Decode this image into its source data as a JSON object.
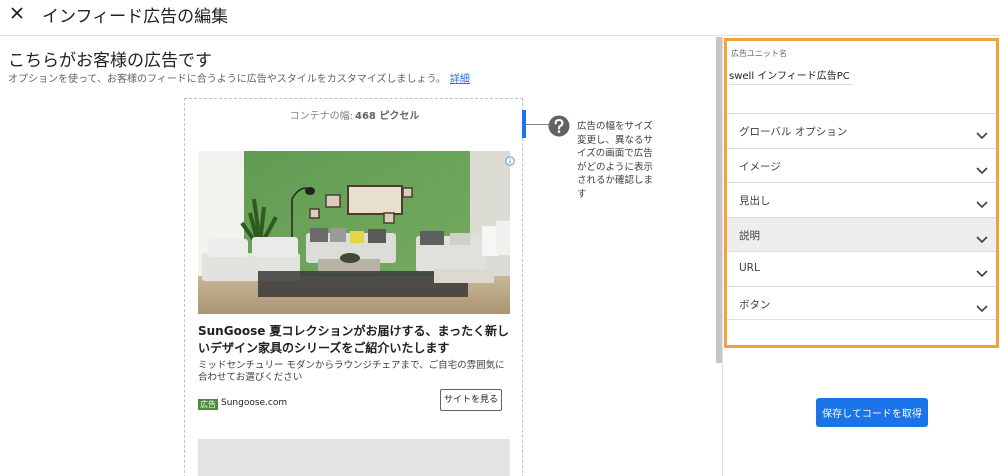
{
  "header": {
    "close_icon": "close-icon",
    "title": "インフィード広告の編集"
  },
  "left": {
    "heading": "こちらがお客様の広告です",
    "subtitle": "オプションを使って、お客様のフィードに合うように広告やスタイルをカスタマイズしましょう。",
    "details_link": "詳細",
    "container_label": "コンテナの幅:",
    "container_value": "468 ピクセル",
    "help_text": "広告の幅をサイズ変更し、異なるサイズの画面で広告がどのように表示されるか確認します",
    "ad": {
      "headline": "SunGoose 夏コレクションがお届けする、まったく新しいデザイン家具のシリーズをご紹介いたします",
      "description": "ミッドセンチュリー モダンからラウンジチェアまで、ご自宅の雰囲気に合わせてお選びください",
      "badge": "広告",
      "domain": "Sungoose.com",
      "cta": "サイトを見る"
    }
  },
  "right": {
    "unit_label": "広告ユニット名",
    "unit_name": "swell インフィード広告PC",
    "sections": [
      {
        "label": "グローバル オプション",
        "active": false
      },
      {
        "label": "イメージ",
        "active": false
      },
      {
        "label": "見出し",
        "active": false
      },
      {
        "label": "説明",
        "active": true
      },
      {
        "label": "URL",
        "active": false
      },
      {
        "label": "ボタン",
        "active": false
      }
    ],
    "save_button": "保存してコードを取得"
  },
  "colors": {
    "accent_blue": "#1a73e8",
    "highlight_border": "#f0a33a",
    "ad_badge": "#4c8c3c",
    "active_section": "#eeeeee"
  }
}
